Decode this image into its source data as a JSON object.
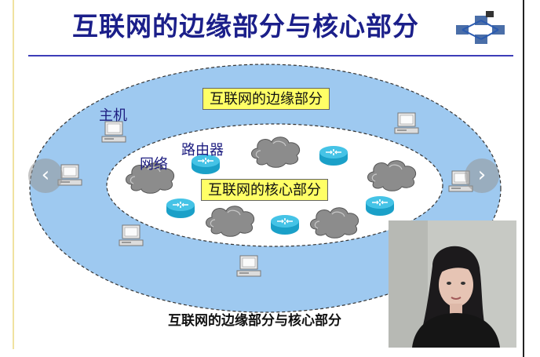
{
  "slide": {
    "title": "互联网的边缘部分与核心部分",
    "edge_label": "互联网的边缘部分",
    "core_label": "互联网的核心部分",
    "host_label": "主机",
    "network_label": "网络",
    "router_label": "路由器",
    "caption": "互联网的边缘部分与核心部分"
  },
  "nav": {
    "prev_symbol": "‹",
    "next_symbol": "›"
  },
  "colors": {
    "title": "#1b1f8a",
    "outer_ellipse": "#9ec9f0",
    "inner_ellipse": "#ffffff",
    "label_box": "#ffff66",
    "router": "#1aa0c8",
    "cloud": "#8c8c8c"
  },
  "icons": [
    "computer-icon",
    "router-icon",
    "cloud-icon",
    "network-logo-icon"
  ]
}
